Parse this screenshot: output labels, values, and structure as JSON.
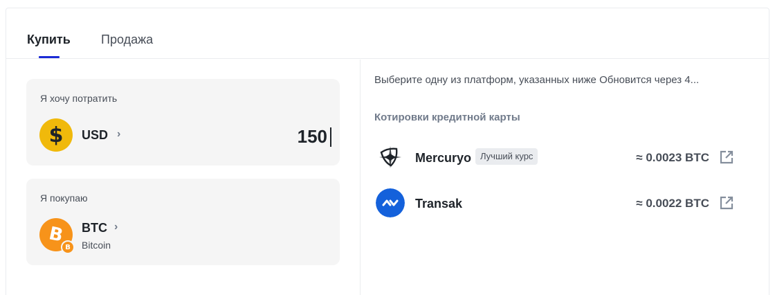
{
  "tabs": [
    {
      "label": "Купить",
      "active": true
    },
    {
      "label": "Продажа",
      "active": false
    }
  ],
  "spend": {
    "label": "Я хочу потратить",
    "currency_code": "USD",
    "currency_icon": "dollar-coin-icon",
    "amount": "150"
  },
  "receive": {
    "label": "Я покупаю",
    "currency_code": "BTC",
    "currency_name": "Bitcoin",
    "currency_icon": "bitcoin-coin-icon"
  },
  "info_text": "Выберите одну из платформ, указанных ниже Обновится через 4...",
  "quotes_title": "Котировки кредитной карты",
  "providers": [
    {
      "name": "Mercuryo",
      "badge": "Лучший курс",
      "rate": "≈ 0.0023 BTC",
      "icon": "mercuryo-logo-icon"
    },
    {
      "name": "Transak",
      "rate": "≈ 0.0022 BTC",
      "icon": "transak-logo-icon"
    }
  ],
  "colors": {
    "accent": "#1b2bd6",
    "panel_bg": "#f5f5f5",
    "usd_coin": "#f0b90b",
    "btc_coin": "#f7931a",
    "transak_blue": "#1461db"
  }
}
